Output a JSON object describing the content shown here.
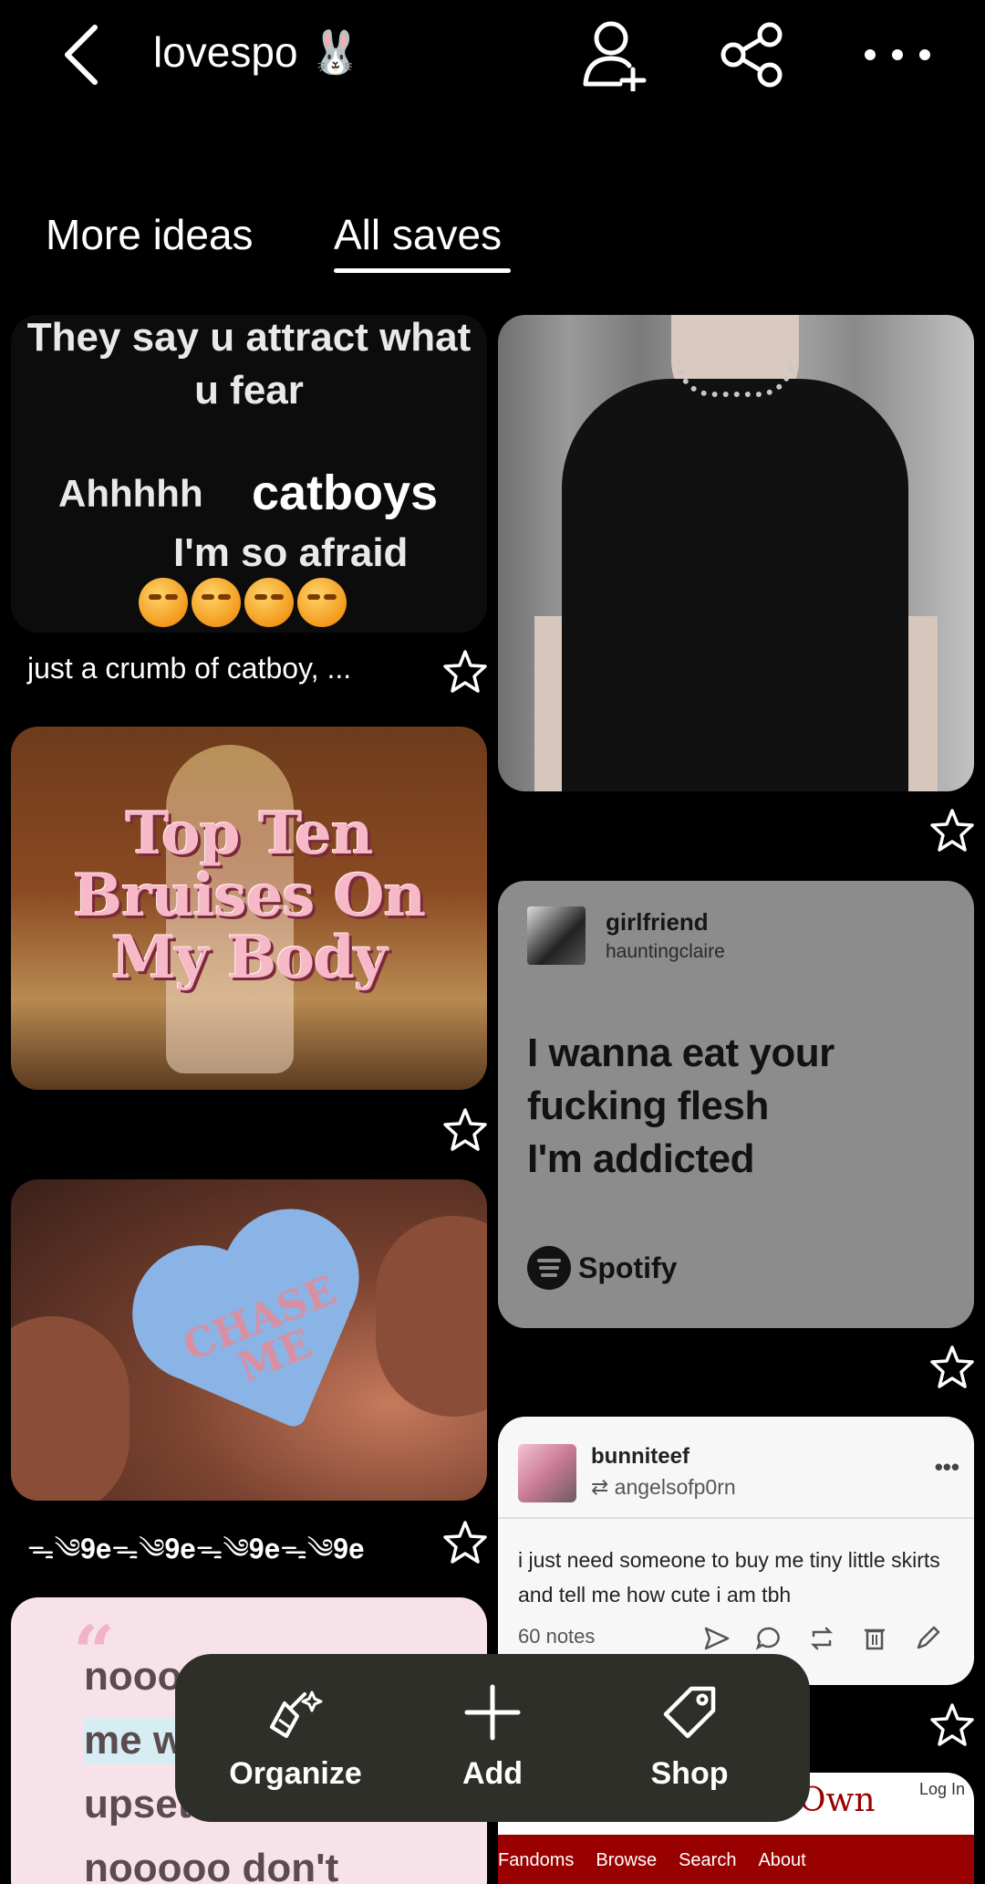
{
  "header": {
    "board_title": "lovespo 🐰",
    "icons": [
      "back-arrow-icon",
      "add-collaborator-icon",
      "share-icon",
      "more-icon"
    ]
  },
  "tabs": [
    {
      "label": "More ideas",
      "active": false
    },
    {
      "label": "All saves",
      "active": true
    }
  ],
  "pins": {
    "meme": {
      "lines": [
        "They say u attract what",
        "u fear",
        "Ahhhhh",
        "catboys",
        "I'm so afraid"
      ],
      "caption": "just a crumb of catboy, ..."
    },
    "topten": {
      "lines": [
        "Top Ten",
        "Bruises On",
        "My Body"
      ]
    },
    "spotify": {
      "track": "girlfriend",
      "artist": "hauntingclaire",
      "lyric": [
        "I wanna eat your",
        "fucking flesh",
        "I'm addicted"
      ],
      "brand": "Spotify"
    },
    "candy": {
      "text": [
        "CHASE",
        "ME"
      ],
      "caption": "ᯓ༄𝟗𝐞ᯓ༄𝟗𝐞ᯓ༄𝟗𝐞ᯓ༄𝟗𝐞"
    },
    "tumblr": {
      "user": "bunniteef",
      "reblog_from": "angelsofp0rn",
      "more": "•••",
      "body": "i just need someone to buy me tiny little skirts and tell me how cute i am tbh",
      "notes": "60 notes"
    },
    "quote": {
      "mark": "“",
      "lines": [
        "nooo",
        "me w",
        "upset",
        "nooooo don't"
      ]
    },
    "ao3": {
      "title_fragment": "Own",
      "login": "Log In",
      "nav": [
        "Fandoms",
        "Browse",
        "Search",
        "About"
      ]
    }
  },
  "bottom_bar": {
    "organize": "Organize",
    "add": "Add",
    "shop": "Shop"
  },
  "colors": {
    "background": "#000000",
    "bottom_bar": "#2f2f2a",
    "ao3_red": "#990000",
    "spotify_card": "#8c8c8c"
  }
}
